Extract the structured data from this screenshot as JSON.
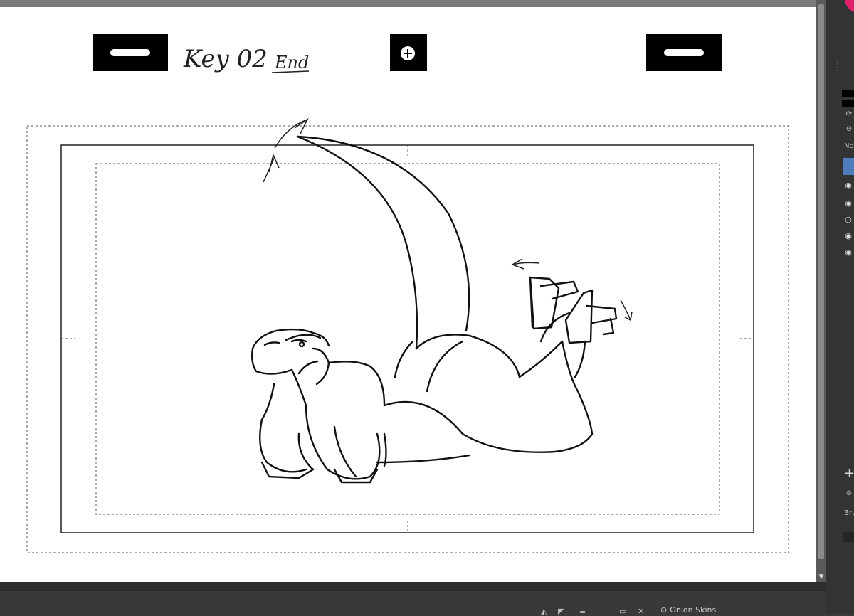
{
  "scene": {
    "key_label": "Key 02",
    "end_label": "End"
  },
  "bottom_bar": {
    "onion_label": "Onion Skins",
    "icons": [
      "layers-icon",
      "arrow-icon",
      "menu-icon",
      "frame-icon",
      "close-icon",
      "lock-icon"
    ]
  },
  "right_panel": {
    "blend_label": "No",
    "brush_label": "Bru",
    "accent_color": "#e0206a",
    "selected_color": "#4f7dbb"
  },
  "colors": {
    "canvas_bg": "#ffffff",
    "ui_dark": "#3a3a3a",
    "ink": "#111111"
  }
}
